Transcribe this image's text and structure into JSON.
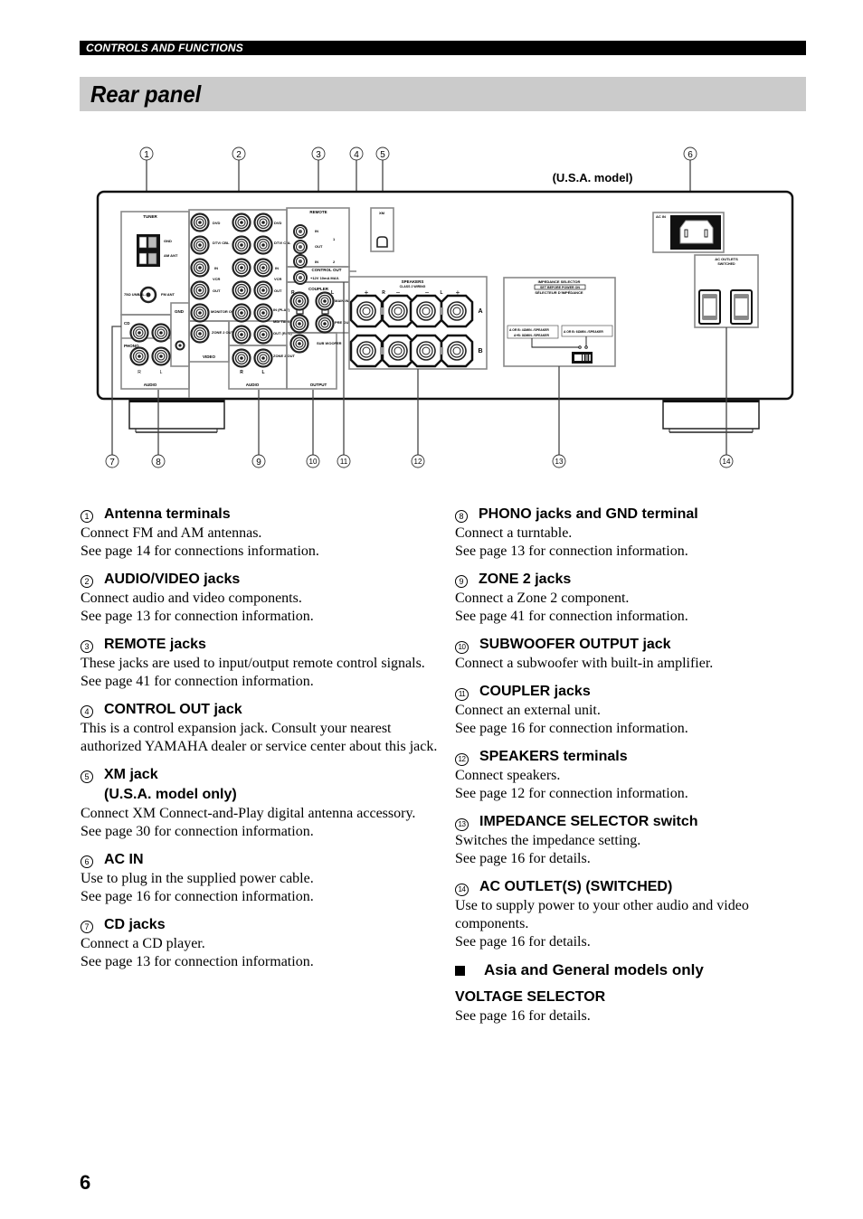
{
  "header": {
    "section": "CONTROLS AND FUNCTIONS",
    "title": "Rear panel"
  },
  "diagram": {
    "model_note": "(U.S.A. model)",
    "callouts_top": [
      "1",
      "2",
      "3",
      "4",
      "5",
      "6"
    ],
    "callouts_bottom": [
      "7",
      "8",
      "9",
      "10",
      "11",
      "12",
      "13",
      "14"
    ],
    "labels": {
      "tuner": "TUNER",
      "gnd": "GND",
      "am_ant": "AM ANT",
      "fm_ant": "FM ANT",
      "unbal": "75Ω UNBAL.",
      "cd": "CD",
      "phono": "PHONO",
      "audio": "AUDIO",
      "video": "VIDEO",
      "output": "OUTPUT",
      "dvd": "DVD",
      "dtv_cbl": "DTV/ CBL",
      "in": "IN",
      "out": "OUT",
      "vcr": "VCR",
      "monitor_out": "MONITOR OUT",
      "zone2_out": "ZONE 2 OUT",
      "in_play": "IN (PLAY)",
      "md_tape": "MD/ TAPE",
      "out_rec": "OUT (REC)",
      "remote": "REMOTE",
      "remote_1": "1",
      "remote_2": "2",
      "control_out": "CONTROL OUT",
      "control_out_spec": "+12V 10mA MAX.",
      "coupler": "COUPLER",
      "main_in": "MAIN IN",
      "pre_out": "PRE OUT",
      "subwoofer": "SUB WOOFER",
      "xm": "XM",
      "speakers": "SPEAKERS",
      "class2": "CLASS 2 WIRING",
      "speaker_a": "A",
      "speaker_b": "B",
      "plus": "+",
      "minus": "−",
      "right": "R",
      "left": "L",
      "impedance_title": "IMPEDANCE SELECTOR",
      "impedance_warn": "SET BEFORE POWER ON",
      "impedance_fr": "SÉLECTEUR D'IMPÉDANCE",
      "imp_opt1_a": "A OR B: 4ΩMIN. /SPEAKER",
      "imp_opt1_b": "A+B: 8ΩMIN. /SPEAKER",
      "imp_opt2": "A OR B: 6ΩMIN. /SPEAKER",
      "ac_in": "AC IN",
      "ac_outlets": "AC OUTLETS",
      "switched": "SWITCHED"
    }
  },
  "items_left": [
    {
      "num": "1",
      "title": "Antenna terminals",
      "body": "Connect FM and AM antennas.\nSee page 14 for connections information."
    },
    {
      "num": "2",
      "title": "AUDIO/VIDEO jacks",
      "body": "Connect audio and video components.\nSee page 13 for connection information."
    },
    {
      "num": "3",
      "title": "REMOTE jacks",
      "body": "These jacks are used to input/output remote control signals.\nSee page 41 for connection information."
    },
    {
      "num": "4",
      "title": "CONTROL OUT jack",
      "body": "This is a control expansion jack. Consult your nearest authorized YAMAHA dealer or service center about this jack."
    },
    {
      "num": "5",
      "title": "XM jack\n(U.S.A. model only)",
      "body": "Connect XM Connect-and-Play digital antenna accessory.\nSee page 30 for connection information."
    },
    {
      "num": "6",
      "title": "AC IN",
      "body": "Use to plug in the supplied power cable.\nSee page 16 for connection information."
    },
    {
      "num": "7",
      "title": "CD jacks",
      "body": "Connect a CD player.\nSee page 13 for connection information."
    }
  ],
  "items_right": [
    {
      "num": "8",
      "title": "PHONO jacks and GND terminal",
      "body": "Connect a turntable.\nSee page 13 for connection information."
    },
    {
      "num": "9",
      "title": "ZONE 2 jacks",
      "body": "Connect a Zone 2 component.\nSee page 41 for connection information."
    },
    {
      "num": "10",
      "title": "SUBWOOFER OUTPUT jack",
      "body": "Connect a subwoofer with built-in amplifier."
    },
    {
      "num": "11",
      "title": "COUPLER jacks",
      "body": "Connect an external unit.\nSee page 16 for connection information."
    },
    {
      "num": "12",
      "title": "SPEAKERS terminals",
      "body": "Connect speakers.\nSee page 12 for connection information."
    },
    {
      "num": "13",
      "title": "IMPEDANCE SELECTOR switch",
      "body": "Switches the impedance setting.\nSee page 16 for details."
    },
    {
      "num": "14",
      "title": "AC OUTLET(S) (SWITCHED)",
      "body": "Use to supply power to your other audio and video components.\nSee page 16 for details."
    }
  ],
  "asia_section": {
    "heading": "Asia and General models only",
    "subheading": "VOLTAGE SELECTOR",
    "body": "See page 16 for details."
  },
  "footer": {
    "page_number": "6"
  }
}
